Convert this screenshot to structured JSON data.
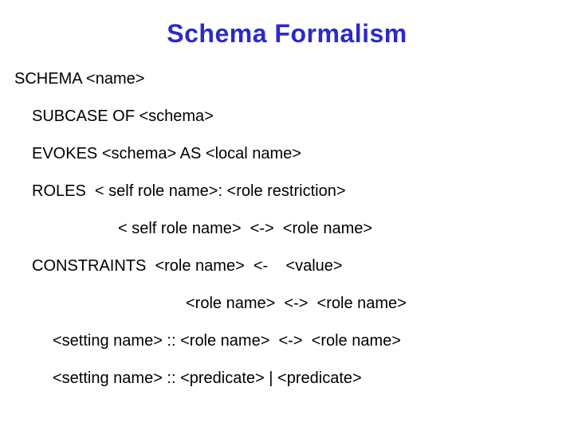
{
  "title": "Schema Formalism",
  "lines": {
    "schema": "SCHEMA <name>",
    "subcase": "SUBCASE OF <schema>",
    "evokes": "EVOKES <schema> AS <local name>",
    "roles1": "ROLES  < self role name>: <role restriction>",
    "roles2": "< self role name>  <->  <role name>",
    "constraints1": "CONSTRAINTS  <role name>  <-    <value>",
    "constraints2": "<role name>  <->  <role name>",
    "setting1": "<setting name> :: <role name>  <->  <role name>",
    "setting2": "<setting name> :: <predicate> | <predicate>"
  }
}
